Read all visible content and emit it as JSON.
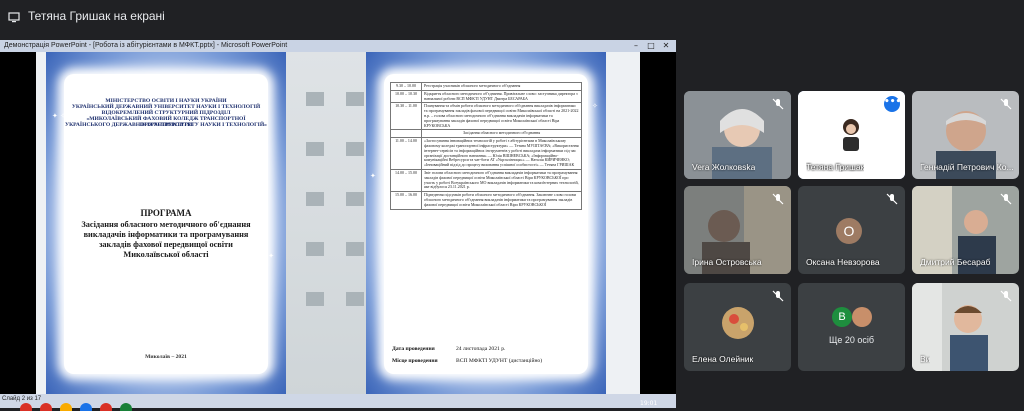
{
  "meet": {
    "presenting_title": "Тетяна Гришак на екрані",
    "participants": [
      {
        "name": "Vera Жолковska",
        "muted": true
      },
      {
        "name": "Тетяна Гришак",
        "muted": false
      },
      {
        "name": "Геннадій Петрович Ко...",
        "muted": true
      },
      {
        "name": "Ірина Островська",
        "muted": true
      },
      {
        "name": "Оксана Невзорова",
        "muted": true,
        "initial": "О"
      },
      {
        "name": "Дмитрий Бесараб",
        "muted": true
      },
      {
        "name": "Елена Олейник",
        "muted": true
      },
      {
        "name": "Ви",
        "muted": true
      }
    ],
    "more": {
      "initial": "В",
      "label": "Ще 20 осіб"
    },
    "more_button": "•••"
  },
  "powerpoint": {
    "window_title": "Демонстрація PowerPoint - [Робота із абітурієнтами в МФКТ.pptx] - Microsoft PowerPoint",
    "status": "Слайд 2 из 17",
    "clock": "19:01",
    "win_min": "–",
    "win_max": "□",
    "win_close": "✕"
  },
  "slide_left": {
    "header": [
      "МІНІСТЕРСТВО ОСВІТИ І НАУКИ УКРАЇНИ",
      "УКРАЇНСЬКИЙ ДЕРЖАВНИЙ УНІВЕРСИТЕТ НАУКИ І ТЕХНОЛОГІЙ",
      "ВІДОКРЕМЛЕНИЙ СТРУКТУРНИЙ ПІДРОЗДІЛ",
      "«МИКОЛАЇВСЬКИЙ ФАХОВИЙ КОЛЕДЖ ТРАНСПОРТНОЇ ІНФРАСТРУКТУРИ",
      "УКРАЇНСЬКОГО ДЕРЖАВНОГО УНІВЕРСИТЕТУ НАУКИ І ТЕХНОЛОГІЙ»"
    ],
    "program_title": "ПРОГРАМА",
    "program_subtitle": "Засідання обласного методичного об'єднання викладачів інформатики та програмування закладів фахової передвищої освіти Миколаївської області",
    "city_year": "Миколаїв – 2021"
  },
  "slide_right": {
    "rows": [
      [
        "9.30 – 10.00",
        "Реєстрація учасників обласного методичного об'єднання"
      ],
      [
        "10.00 – 10.30",
        "Відкриття обласного методичного об'єднання. Привітальне слово: заступника директора з навчальної роботи ВСП МФКТІ УДУНТ Дмитра БЕСАРАБА"
      ],
      [
        "10.30 – 11.00",
        "Планування та обмін роботи обласного методичного об'єднання викладачів інформатики та програмування закладів фахової передвищої освіти Миколаївської області на 2021-2022 н.р. – голова обласного методичного об'єднання викладачів інформатики та програмування закладів фахової передвищої освіти Миколаївської області Віра КРУКОВСЬКА"
      ],
      [
        "",
        "Засідання обласного методичного об'єднання"
      ],
      [
        "11.00 – 14.00",
        "«Застосування інноваційних технологій у роботі з абітурієнтами в Миколаївському фаховому коледжі транспортної інфраструктури» — Тетяна МУШТАЄВА; «Використання інтернет-сервісів та інформаційних інструментів у роботі викладача інформатики під час організації дистанційного навчання» — Юлія ВІШНЕВСЬКА; «Інформаційно-комунікаційні Вебресурси та чат-боти AT «Укрзалізниця»» — Наталія КИРИЧЕНКО; «Інноваційний підхід до процесу виховання успішної особистості» — Тетяна ГРИШАК"
      ],
      [
        "14.00 – 15.00",
        "Звіт голови обласного методичного об'єднання викладачів інформатики та програмування закладів фахової передвищої освіти Миколаївської області Віри КРУКОВСЬКОЇ про участь у роботі Всеукраїнського МО викладачів інформатики та комп'ютерних технологій, яке відбулося 23.11.2021 р."
      ],
      [
        "15.00 – 16.00",
        "Підведення підсумків роботи обласного методичного об'єднання. Заключне слово голови обласного методичного об'єднання викладачів інформатики та програмування закладів фахової передвищої освіти Миколаївської області Віри КРУКОВСЬКОЇ"
      ]
    ],
    "date_label": "Дата проведення",
    "date_value": "24 листопада 2021 р.",
    "place_label": "Місце проведення",
    "place_value": "ВСП МФКТІ УДУНТ (дистанційно)"
  }
}
